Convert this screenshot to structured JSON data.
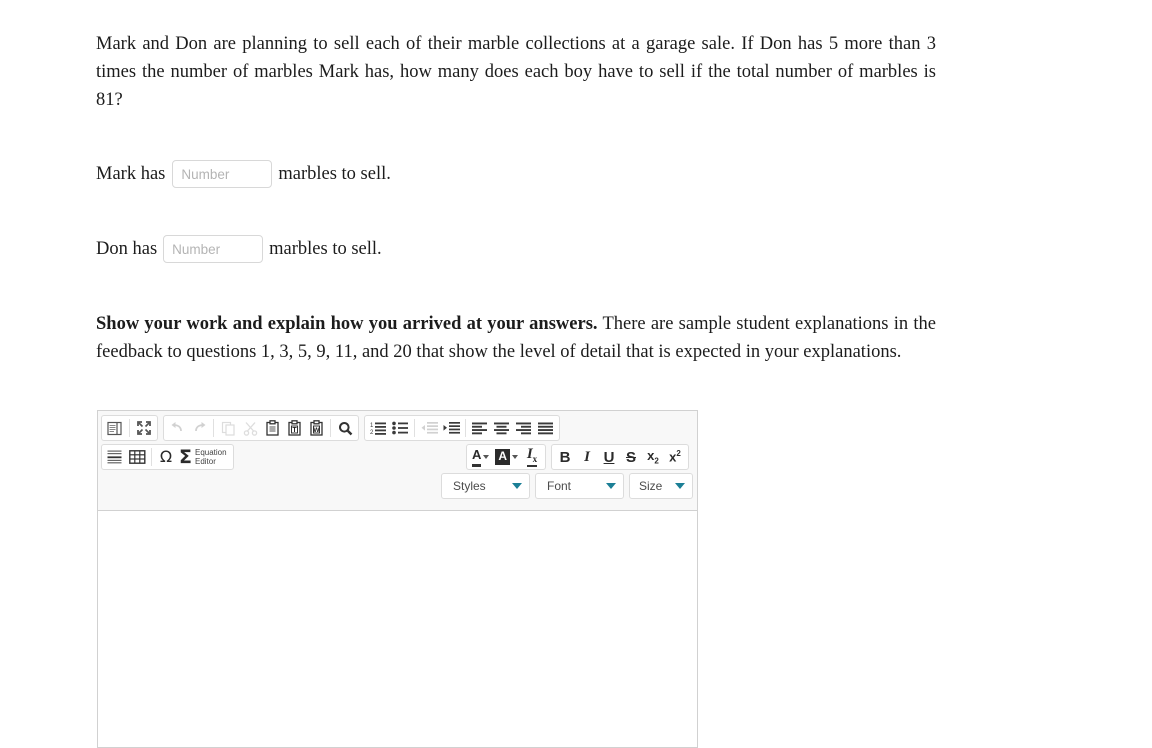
{
  "question": {
    "prompt": "Mark and Don are planning to sell each of their marble collections at a garage sale. If Don has 5 more than 3 times the number of marbles Mark has, how many does each boy have to sell if the total number of marbles is 81?",
    "answers": [
      {
        "label_before": "Mark has",
        "label_after": "marbles to sell.",
        "placeholder": "Number",
        "value": ""
      },
      {
        "label_before": "Don has",
        "label_after": "marbles to sell.",
        "placeholder": "Number",
        "value": ""
      }
    ],
    "instruction_bold": "Show your work and explain how you arrived at your answers.",
    "instruction_rest": " There are sample student explanations in the feedback to questions 1, 3, 5, 9, 11, and 20 that show the level of detail that is expected in your explanations."
  },
  "editor": {
    "content": "",
    "toolbar": {
      "row1_group1": [
        {
          "name": "source-icon",
          "title": "Source"
        },
        {
          "name": "maximize-icon",
          "title": "Maximize"
        }
      ],
      "row1_group2": [
        {
          "name": "undo-icon",
          "title": "Undo",
          "disabled": true
        },
        {
          "name": "redo-icon",
          "title": "Redo",
          "disabled": true
        },
        {
          "name": "copy-icon",
          "title": "Copy",
          "disabled": true
        },
        {
          "name": "cut-icon",
          "title": "Cut",
          "disabled": true
        },
        {
          "name": "paste-icon",
          "title": "Paste"
        },
        {
          "name": "paste-text-icon",
          "title": "Paste as plain text"
        },
        {
          "name": "paste-word-icon",
          "title": "Paste from Word"
        },
        {
          "name": "find-icon",
          "title": "Find"
        }
      ],
      "row1_group3": [
        {
          "name": "numbered-list-icon",
          "title": "Insert/Remove Numbered List"
        },
        {
          "name": "bulleted-list-icon",
          "title": "Insert/Remove Bulleted List"
        },
        {
          "name": "outdent-icon",
          "title": "Decrease Indent",
          "disabled": true
        },
        {
          "name": "indent-icon",
          "title": "Increase Indent"
        },
        {
          "name": "align-left-icon",
          "title": "Align Left"
        },
        {
          "name": "align-center-icon",
          "title": "Center"
        },
        {
          "name": "align-right-icon",
          "title": "Align Right"
        },
        {
          "name": "align-justify-icon",
          "title": "Justify"
        }
      ],
      "row2_group1": [
        {
          "name": "horizontal-rule-icon",
          "title": "Insert Horizontal Line"
        },
        {
          "name": "table-icon",
          "title": "Table"
        },
        {
          "name": "special-char-icon",
          "title": "Insert Special Character",
          "glyph": "Ω"
        }
      ],
      "equation_editor": {
        "glyph": "Σ",
        "label": "Equation\nEditor"
      },
      "row2_group2": [
        {
          "name": "text-color-icon",
          "title": "Text Color",
          "glyph": "A"
        },
        {
          "name": "background-color-icon",
          "title": "Background Color",
          "glyph": "A"
        },
        {
          "name": "remove-format-icon",
          "title": "Remove Format",
          "glyph": "I"
        }
      ],
      "row2_group3": [
        {
          "name": "bold-icon",
          "title": "Bold",
          "glyph": "B"
        },
        {
          "name": "italic-icon",
          "title": "Italic",
          "glyph": "I"
        },
        {
          "name": "underline-icon",
          "title": "Underline",
          "glyph": "U"
        },
        {
          "name": "strikethrough-icon",
          "title": "Strikethrough",
          "glyph": "S"
        },
        {
          "name": "subscript-icon",
          "title": "Subscript",
          "glyph": "x"
        },
        {
          "name": "superscript-icon",
          "title": "Superscript",
          "glyph": "x"
        }
      ],
      "selects": [
        {
          "name": "styles-select",
          "label": "Styles"
        },
        {
          "name": "font-select",
          "label": "Font"
        },
        {
          "name": "size-select",
          "label": "Size"
        }
      ]
    }
  },
  "colors": {
    "text": "#1c1c1c",
    "placeholder": "#b4b4b4",
    "toolbar_bg": "#f8f8f8",
    "border": "#d1d1d1",
    "caret_accent": "#1b7f96"
  }
}
